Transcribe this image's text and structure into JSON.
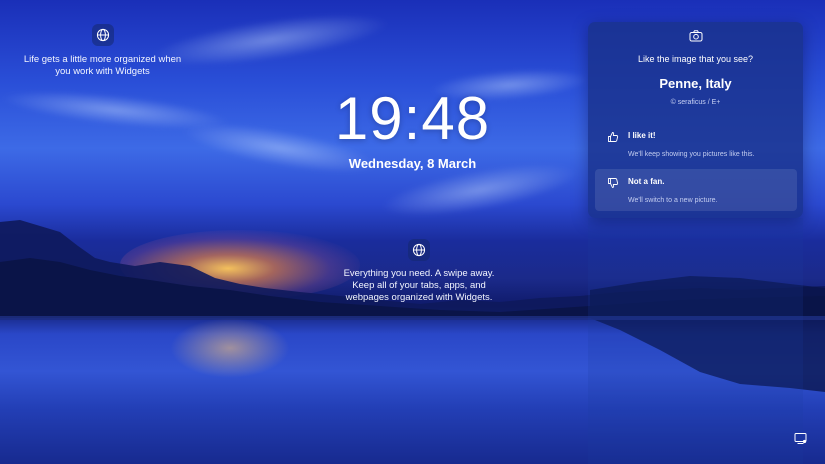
{
  "clock": {
    "time": "19:48",
    "date": "Wednesday, 8 March"
  },
  "widgets_hint_top": {
    "icon": "globe-icon",
    "line1": "Life gets a little more organized when",
    "line2": "you work with Widgets"
  },
  "widgets_hint_center": {
    "icon": "globe-icon",
    "line1": "Everything you need. A swipe away.",
    "line2": "Keep all of your tabs, apps, and",
    "line3": "webpages organized with Widgets."
  },
  "spotlight": {
    "icon": "camera-icon",
    "question": "Like the image that you see?",
    "place": "Penne, Italy",
    "credit": "© seraficus / E+",
    "options": [
      {
        "icon": "thumbs-up-icon",
        "title": "I like it!",
        "subtitle": "We'll keep showing you pictures like this."
      },
      {
        "icon": "thumbs-down-icon",
        "title": "Not a fan.",
        "subtitle": "We'll switch to a new picture."
      }
    ]
  },
  "tray": {
    "icon": "notification-icon"
  },
  "colors": {
    "panel": "#1a328c",
    "sky": "#2a4fd8",
    "sunset": "#ffc85a"
  }
}
